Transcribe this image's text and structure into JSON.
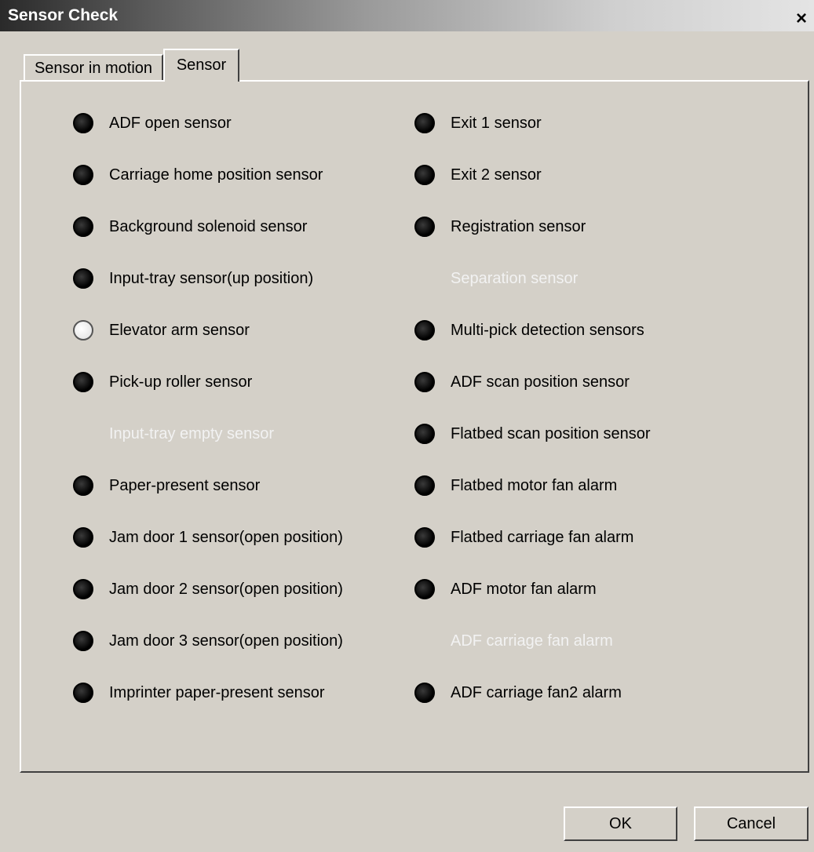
{
  "window": {
    "title": "Sensor Check",
    "close_label": "×"
  },
  "tabs": [
    {
      "label": "Sensor in motion",
      "active": false
    },
    {
      "label": "Sensor",
      "active": true
    }
  ],
  "sensors_left": [
    {
      "label": "ADF open sensor",
      "state": "off"
    },
    {
      "label": "Carriage home position sensor",
      "state": "off"
    },
    {
      "label": "Background solenoid sensor",
      "state": "off"
    },
    {
      "label": "Input-tray sensor(up position)",
      "state": "off"
    },
    {
      "label": "Elevator arm sensor",
      "state": "on"
    },
    {
      "label": "Pick-up roller sensor",
      "state": "off"
    },
    {
      "label": "Input-tray empty sensor",
      "state": "disabled"
    },
    {
      "label": "Paper-present sensor",
      "state": "off"
    },
    {
      "label": "Jam door 1 sensor(open position)",
      "state": "off"
    },
    {
      "label": "Jam door 2 sensor(open position)",
      "state": "off"
    },
    {
      "label": "Jam door 3 sensor(open position)",
      "state": "off"
    },
    {
      "label": "Imprinter paper-present sensor",
      "state": "off"
    }
  ],
  "sensors_right": [
    {
      "label": "Exit 1 sensor",
      "state": "off"
    },
    {
      "label": "Exit 2 sensor",
      "state": "off"
    },
    {
      "label": "Registration sensor",
      "state": "off"
    },
    {
      "label": "Separation sensor",
      "state": "disabled"
    },
    {
      "label": "Multi-pick detection sensors",
      "state": "off"
    },
    {
      "label": "ADF scan position sensor",
      "state": "off"
    },
    {
      "label": "Flatbed scan position sensor",
      "state": "off"
    },
    {
      "label": "Flatbed motor fan alarm",
      "state": "off"
    },
    {
      "label": "Flatbed carriage fan alarm",
      "state": "off"
    },
    {
      "label": "ADF motor fan alarm",
      "state": "off"
    },
    {
      "label": "ADF carriage fan alarm",
      "state": "disabled"
    },
    {
      "label": "ADF carriage fan2 alarm",
      "state": "off"
    }
  ],
  "buttons": {
    "ok_label": "OK",
    "cancel_label": "Cancel"
  }
}
